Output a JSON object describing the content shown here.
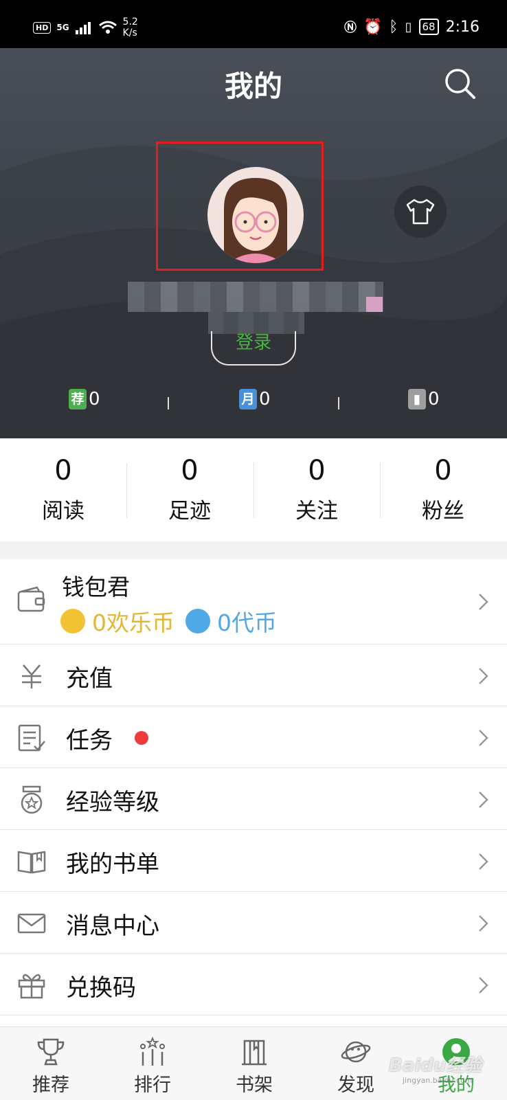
{
  "status_bar": {
    "hd": "HD",
    "net": "5G",
    "speed_top": "5.2",
    "speed_bottom": "K/s",
    "battery": "68",
    "time": "2:16"
  },
  "header": {
    "title": "我的",
    "login": "登录",
    "stats": [
      {
        "badge": "荐",
        "badge_color": "#4caf50",
        "value": "0"
      },
      {
        "badge": "月",
        "badge_color": "#4a90d9",
        "value": "0"
      },
      {
        "badge": "",
        "badge_color": "#9e9e9e",
        "value": "0"
      }
    ]
  },
  "counts": [
    {
      "value": "0",
      "label": "阅读"
    },
    {
      "value": "0",
      "label": "足迹"
    },
    {
      "value": "0",
      "label": "关注"
    },
    {
      "value": "0",
      "label": "粉丝"
    }
  ],
  "wallet": {
    "title": "钱包君",
    "happy_coin": "0欢乐币",
    "voucher": "0代币",
    "happy_color": "#e5b534",
    "voucher_color": "#4fa9e6"
  },
  "menu": [
    {
      "label": "充值",
      "icon": "yen-icon"
    },
    {
      "label": "任务",
      "icon": "task-icon"
    },
    {
      "label": "经验等级",
      "icon": "medal-icon"
    },
    {
      "label": "我的书单",
      "icon": "book-icon"
    },
    {
      "label": "消息中心",
      "icon": "mail-icon"
    },
    {
      "label": "兑换码",
      "icon": "gift-icon"
    }
  ],
  "bottom_nav": [
    {
      "label": "推荐",
      "icon": "trophy-icon"
    },
    {
      "label": "排行",
      "icon": "ranking-icon"
    },
    {
      "label": "书架",
      "icon": "bookshelf-icon"
    },
    {
      "label": "发现",
      "icon": "planet-icon"
    },
    {
      "label": "我的",
      "icon": "profile-icon"
    }
  ],
  "watermark": {
    "text": "Baidu经验",
    "sub": "jingyan.baidu.com"
  },
  "colors": {
    "accent": "#3aa944",
    "highlight_box": "#e02020",
    "notification": "#ef3b3b"
  }
}
